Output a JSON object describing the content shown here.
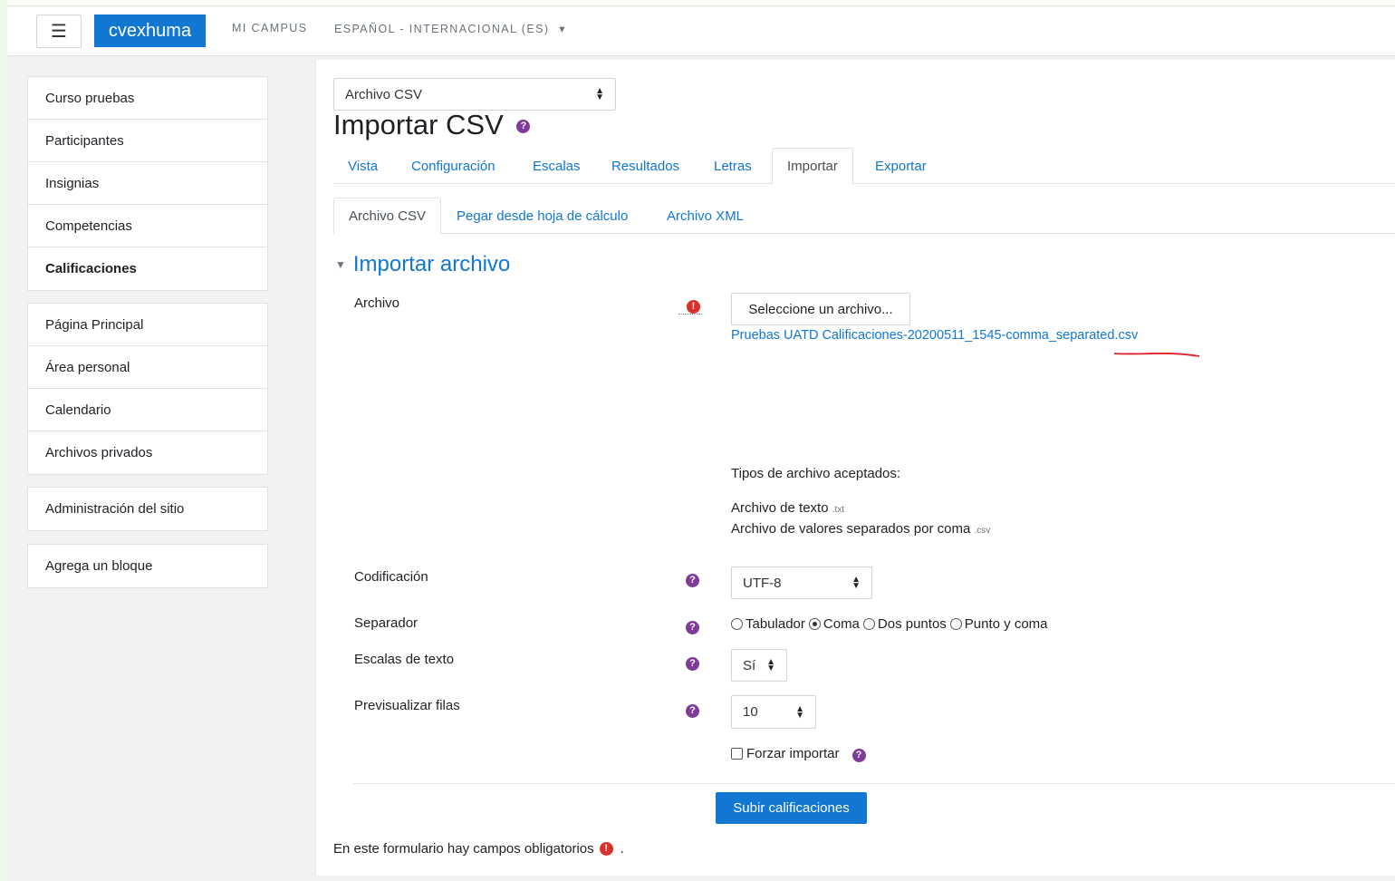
{
  "navbar": {
    "menu_icon": "hamburger-icon",
    "brand": "cvexhuma",
    "links": [
      "MI CAMPUS",
      "ESPAÑOL - INTERNACIONAL (ES)"
    ],
    "lang_caret": "▾"
  },
  "sidebar": {
    "course_nav": [
      "Curso pruebas",
      "Participantes",
      "Insignias",
      "Competencias",
      "Calificaciones"
    ],
    "site_nav": [
      "Página Principal",
      "Área personal",
      "Calendario",
      "Archivos privados"
    ],
    "admin": "Administración del sitio",
    "add_block": "Agrega un bloque"
  },
  "main": {
    "import_select": "Archivo CSV",
    "title": "Importar CSV",
    "tabs": [
      "Vista",
      "Configuración",
      "Escalas",
      "Resultados",
      "Letras",
      "Importar",
      "Exportar"
    ],
    "subtabs": [
      "Archivo CSV",
      "Pegar desde hoja de cálculo",
      "Archivo XML"
    ],
    "section": "Importar archivo",
    "fields": {
      "file_label": "Archivo",
      "file_button": "Seleccione un archivo...",
      "file_name": "Pruebas UATD Calificaciones-20200511_1545-comma_separated.csv",
      "accepted_title": "Tipos de archivo aceptados:",
      "accepted_1": "Archivo de texto",
      "accepted_1_ext": ".txt",
      "accepted_2": "Archivo de valores separados por coma",
      "accepted_2_ext": ".csv",
      "encoding_label": "Codificación",
      "encoding_value": "UTF-8",
      "separator_label": "Separador",
      "separator_options": [
        "Tabulador",
        "Coma",
        "Dos puntos",
        "Punto y coma"
      ],
      "separator_selected": "Coma",
      "text_scales_label": "Escalas de texto",
      "text_scales_value": "Sí",
      "preview_label": "Previsualizar filas",
      "preview_value": "10",
      "force_import": "Forzar importar"
    },
    "submit": "Subir calificaciones",
    "required_note": "En este formulario hay campos obligatorios",
    "required_note_end": "."
  },
  "colors": {
    "accent": "#1177d1",
    "help": "#7e3b9a",
    "required": "#d9322a",
    "annotation": "#e0202a"
  }
}
